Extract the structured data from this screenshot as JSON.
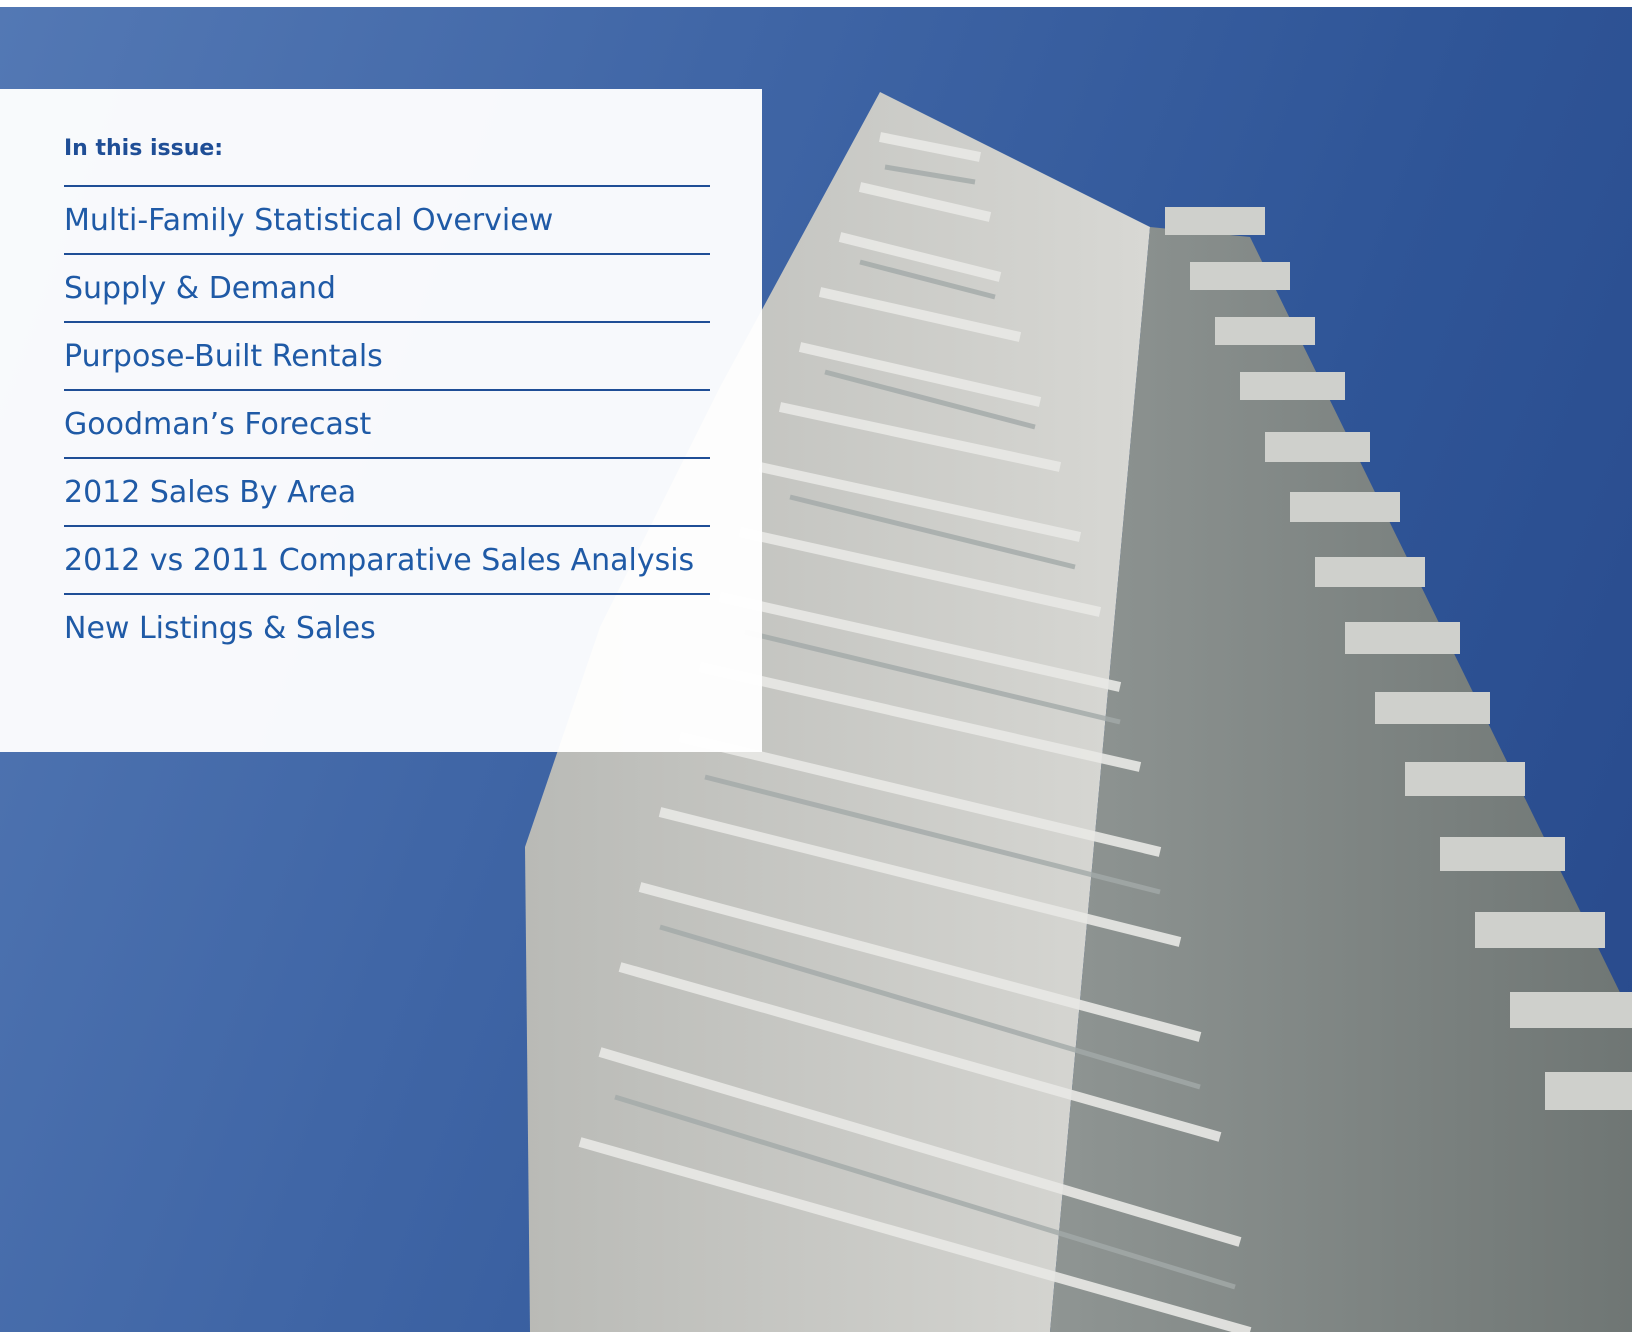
{
  "panel": {
    "heading": "In this issue:",
    "items": [
      {
        "label": "Multi-Family Statistical Overview"
      },
      {
        "label": "Supply & Demand"
      },
      {
        "label": "Purpose-Built Rentals"
      },
      {
        "label": "Goodman’s Forecast"
      },
      {
        "label": "2012 Sales By Area"
      },
      {
        "label": "2012 vs 2011 Comparative Sales Analysis"
      },
      {
        "label": "New Listings & Sales"
      }
    ]
  },
  "colors": {
    "sky": "#3a62a3",
    "building": "#c9c9c4",
    "text": "#1f5aa6"
  }
}
